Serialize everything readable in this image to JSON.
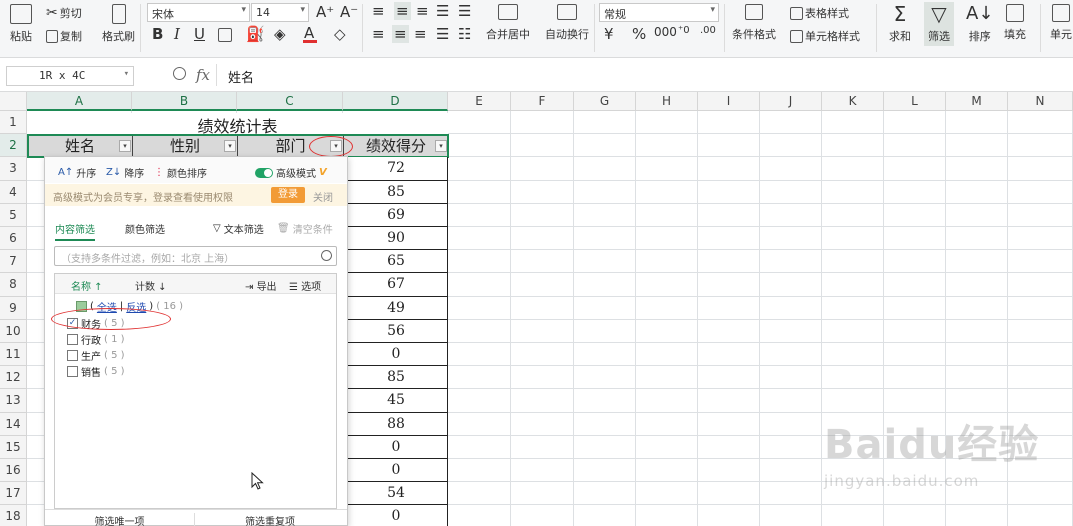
{
  "ribbon": {
    "paste": "粘贴",
    "cut": "剪切",
    "copy": "复制",
    "format_painter": "格式刷",
    "font_name": "宋体",
    "font_size": "14",
    "merge_center": "合并居中",
    "wrap_text": "自动换行",
    "number_format": "常规",
    "cond_format": "条件格式",
    "table_style": "表格样式",
    "cell_style": "单元格样式",
    "sum": "求和",
    "filter": "筛选",
    "sort": "排序",
    "fill": "填充",
    "cell": "单元"
  },
  "formula_bar": {
    "name_box": "1R x 4C",
    "fx": "fx",
    "value": "姓名"
  },
  "columns": [
    "A",
    "B",
    "C",
    "D",
    "E",
    "F",
    "G",
    "H",
    "I",
    "J",
    "K",
    "L",
    "M",
    "N"
  ],
  "rows": [
    "1",
    "2",
    "3",
    "4",
    "5",
    "6",
    "7",
    "8",
    "9",
    "10",
    "11",
    "12",
    "13",
    "14",
    "15",
    "16",
    "17",
    "18"
  ],
  "sheet": {
    "title": "绩效统计表",
    "headers": [
      "姓名",
      "性别",
      "部门",
      "绩效得分"
    ],
    "scores": [
      "72",
      "85",
      "69",
      "90",
      "65",
      "67",
      "49",
      "56",
      "0",
      "85",
      "45",
      "88",
      "0",
      "0",
      "54",
      "0"
    ]
  },
  "filter_panel": {
    "sort_asc": "升序",
    "sort_desc": "降序",
    "color_sort": "颜色排序",
    "advanced_mode": "高级模式",
    "vip_mark": "V",
    "notice": "高级模式为会员专享，登录查看使用权限",
    "login": "登录",
    "close": "关闭",
    "tab_content": "内容筛选",
    "tab_color": "颜色筛选",
    "text_filter": "文本筛选",
    "clear": "清空条件",
    "search_placeholder": "（支持多条件过滤，例如：北京 上海）",
    "col_name": "名称",
    "col_count": "计数",
    "export": "导出",
    "options": "选项",
    "select_all": "全选",
    "invert": "反选",
    "all_count": "( 16 )",
    "items": [
      {
        "label": "财务",
        "count": "( 5 )",
        "checked": true
      },
      {
        "label": "行政",
        "count": "( 1 )",
        "checked": false
      },
      {
        "label": "生产",
        "count": "( 5 )",
        "checked": false
      },
      {
        "label": "销售",
        "count": "( 5 )",
        "checked": false
      }
    ],
    "unique_btn": "筛选唯一项",
    "dup_btn": "筛选重复项"
  },
  "watermark": {
    "main": "Baidu经验",
    "sub": "jingyan.baidu.com"
  }
}
